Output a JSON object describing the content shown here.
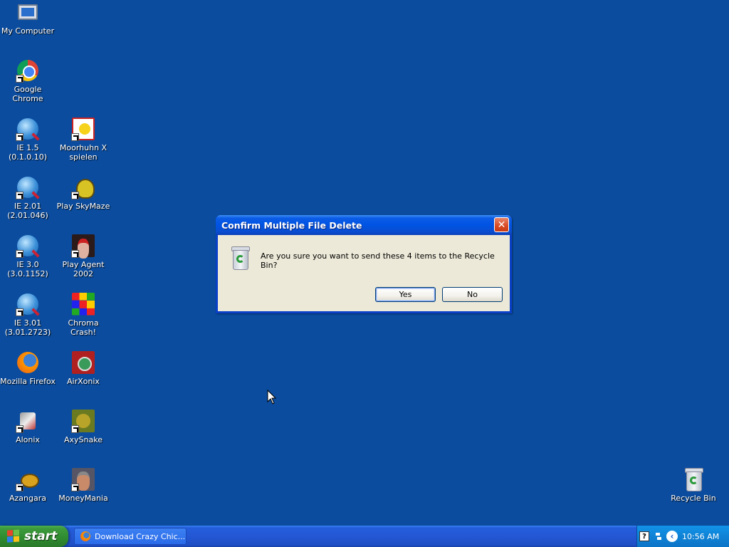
{
  "desktop": {
    "icons": [
      {
        "label": "My Computer",
        "icon": "computer-icon"
      },
      {
        "label": "Google Chrome",
        "icon": "chrome-icon"
      },
      {
        "label": "IE 1.5\n(0.1.0.10)",
        "icon": "internet-explorer-icon"
      },
      {
        "label": "Moorhuhn X\nspielen",
        "icon": "moorhuhn-icon"
      },
      {
        "label": "IE 2.01\n(2.01.046)",
        "icon": "internet-explorer-icon"
      },
      {
        "label": "Play SkyMaze",
        "icon": "skymaze-icon"
      },
      {
        "label": "IE 3.0\n(3.0.1152)",
        "icon": "internet-explorer-icon"
      },
      {
        "label": "Play Agent\n2002",
        "icon": "agent-icon"
      },
      {
        "label": "IE 3.01\n(3.01.2723)",
        "icon": "internet-explorer-icon"
      },
      {
        "label": "Chroma Crash!",
        "icon": "chroma-crash-icon"
      },
      {
        "label": "Mozilla Firefox",
        "icon": "firefox-icon"
      },
      {
        "label": "AirXonix",
        "icon": "airxonix-icon"
      },
      {
        "label": "Alonix",
        "icon": "alonix-icon"
      },
      {
        "label": "AxySnake",
        "icon": "axysnake-icon"
      },
      {
        "label": "Azangara",
        "icon": "azangara-icon"
      },
      {
        "label": "MoneyMania",
        "icon": "moneymania-icon"
      },
      {
        "label": "Recycle Bin",
        "icon": "recycle-bin-icon"
      }
    ]
  },
  "dialog": {
    "title": "Confirm Multiple File Delete",
    "message": "Are you sure you want to send these 4 items to the Recycle Bin?",
    "yes_label": "Yes",
    "no_label": "No",
    "close_glyph": "✕"
  },
  "taskbar": {
    "start_label": "start",
    "task_item_label": "Download Crazy Chic...",
    "clock": "10:56 AM",
    "help_glyph": "?",
    "expand_glyph": "‹"
  },
  "colors": {
    "desktop_bg": "#0b4c9e",
    "title_bar": "#0054e3",
    "start_green": "#2f8a2f",
    "tray_blue": "#0f83d6"
  }
}
